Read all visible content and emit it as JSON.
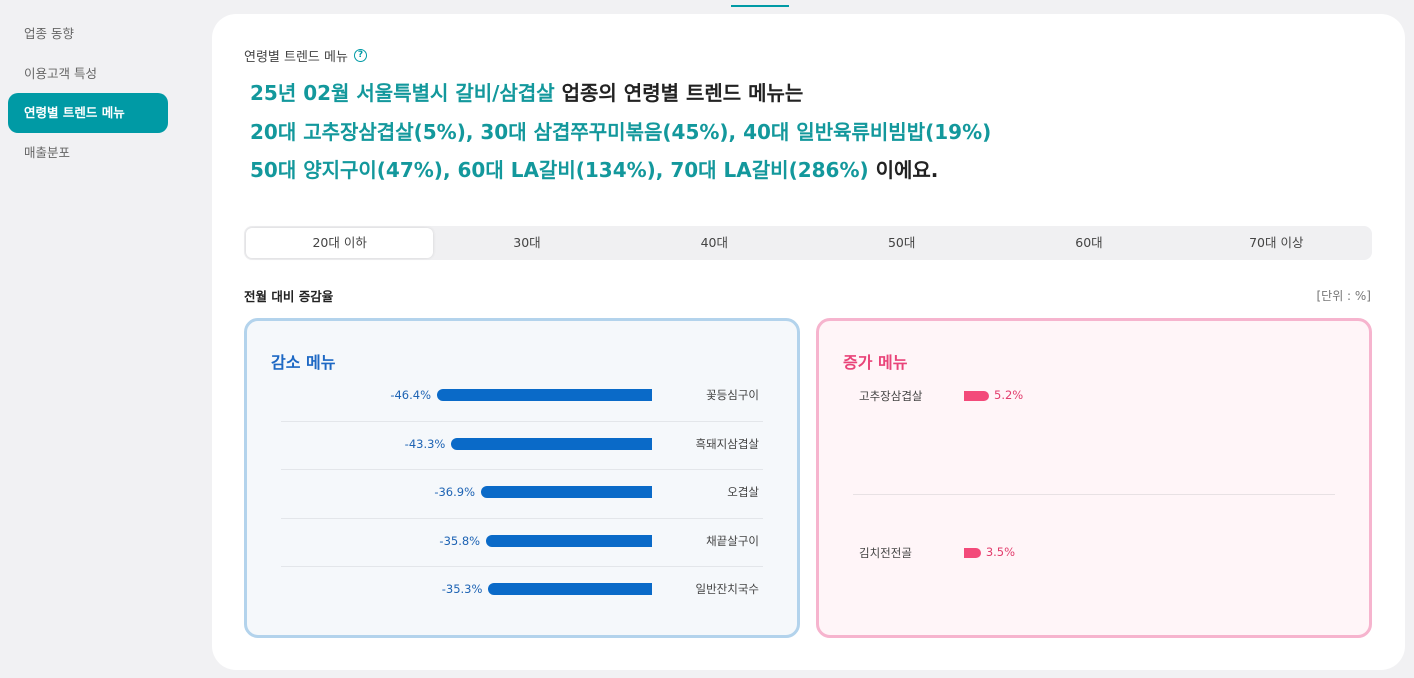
{
  "sidebar": {
    "items": [
      {
        "label": "업종 동향",
        "active": false
      },
      {
        "label": "이용고객 특성",
        "active": false
      },
      {
        "label": "연령별 트렌드 메뉴",
        "active": true
      },
      {
        "label": "매출분포",
        "active": false
      }
    ]
  },
  "main": {
    "section_label": "연령별 트렌드 메뉴",
    "summary": {
      "line1_highlight": "25년 02월 서울특별시 갈비/삼겹살",
      "line1_rest": " 업종의 연령별 트렌드 메뉴는",
      "line2": "20대 고추장삼겹살(5%), 30대 삼겹쭈꾸미볶음(45%), 40대 일반육류비빔밥(19%)",
      "line3_highlight": "50대 양지구이(47%), 60대 LA갈비(134%), 70대 LA갈비(286%)",
      "line3_rest": " 이에요."
    },
    "tabs": [
      "20대 이하",
      "30대",
      "40대",
      "50대",
      "60대",
      "70대 이상"
    ],
    "active_tab": 0,
    "chart_section_title": "전월 대비 증감율",
    "unit_label": "[단위 : %]"
  },
  "decrease": {
    "title": "감소 메뉴",
    "items": [
      {
        "name": "꽃등심구이",
        "value": -46.4,
        "label": "-46.4%"
      },
      {
        "name": "흑돼지삼겹살",
        "value": -43.3,
        "label": "-43.3%"
      },
      {
        "name": "오겹살",
        "value": -36.9,
        "label": "-36.9%"
      },
      {
        "name": "채끝살구이",
        "value": -35.8,
        "label": "-35.8%"
      },
      {
        "name": "일반잔치국수",
        "value": -35.3,
        "label": "-35.3%"
      }
    ]
  },
  "increase": {
    "title": "증가 메뉴",
    "items": [
      {
        "name": "고추장삼겹살",
        "value": 5.2,
        "label": "5.2%"
      },
      {
        "name": "김치전전골",
        "value": 3.5,
        "label": "3.5%"
      }
    ]
  },
  "colors": {
    "accent": "#009aa5",
    "decrease_bar": "#0a6ac8",
    "increase_bar": "#f34a7a"
  }
}
